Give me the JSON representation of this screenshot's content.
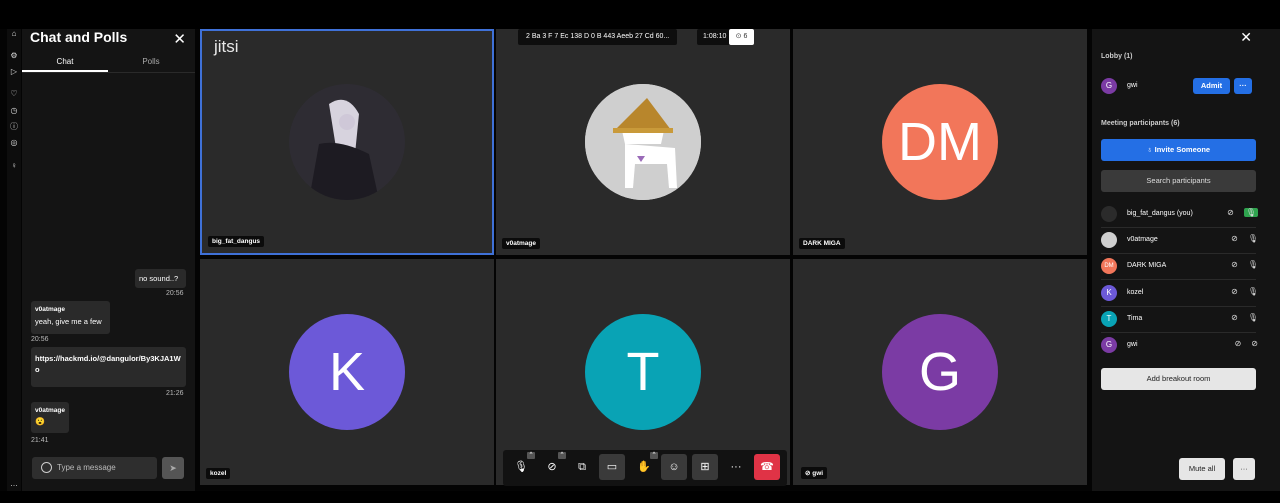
{
  "chat": {
    "title": "Chat and Polls",
    "close": "✕",
    "tabs": [
      "Chat",
      "Polls"
    ],
    "messages": [
      {
        "sender": "",
        "text": "no sound..?",
        "time": "20:56"
      },
      {
        "sender": "v0atmage",
        "text": "yeah, give me a few",
        "time": "20:56"
      },
      {
        "sender": "",
        "text": "https://hackmd.io/@dangulor/By3KJA1Wo",
        "time": "21:26"
      },
      {
        "sender": "v0atmage",
        "text": "😮",
        "time": "21:41"
      }
    ],
    "input_placeholder": "Type a message"
  },
  "meeting": {
    "logo": "jitsi",
    "room_name": "2 Ba 3 F 7 Ec 138 D 0 B 443 Aeeb 27 Cd 60...",
    "timer": "1:08:10",
    "rec_count": "6"
  },
  "tiles": [
    {
      "name": "big_fat_dangus",
      "initials": "",
      "color": "#2b2b2b"
    },
    {
      "name": "v0atmage",
      "initials": "",
      "color": "#cfcfcf"
    },
    {
      "name": "DARK MIGA",
      "initials": "DM",
      "color": "#f2765a"
    },
    {
      "name": "kozel",
      "initials": "K",
      "color": "#6c59d8"
    },
    {
      "name": "",
      "initials": "T",
      "color": "#09a3b5"
    },
    {
      "name": "gwi",
      "initials": "G",
      "color": "#7b3ba4"
    }
  ],
  "people": {
    "close": "✕",
    "lobby_label": "Lobby (1)",
    "lobby_user": {
      "initial": "G",
      "name": "gwi",
      "color": "#7b3ba4"
    },
    "admit_label": "Admit",
    "more_label": "···",
    "participants_label": "Meeting participants (6)",
    "invite_label": "Invite Someone",
    "search_placeholder": "Search participants",
    "list": [
      {
        "initial": "",
        "name": "big_fat_dangus (you)",
        "color": "#2b2b2b"
      },
      {
        "initial": "",
        "name": "v0atmage",
        "color": "#cfcfcf"
      },
      {
        "initial": "DM",
        "name": "DARK MIGA",
        "color": "#f2765a"
      },
      {
        "initial": "K",
        "name": "kozel",
        "color": "#6c59d8"
      },
      {
        "initial": "T",
        "name": "Tima",
        "color": "#09a3b5"
      },
      {
        "initial": "G",
        "name": "gwi",
        "color": "#7b3ba4"
      }
    ],
    "breakout_label": "Add breakout room",
    "mute_all_label": "Mute all"
  }
}
